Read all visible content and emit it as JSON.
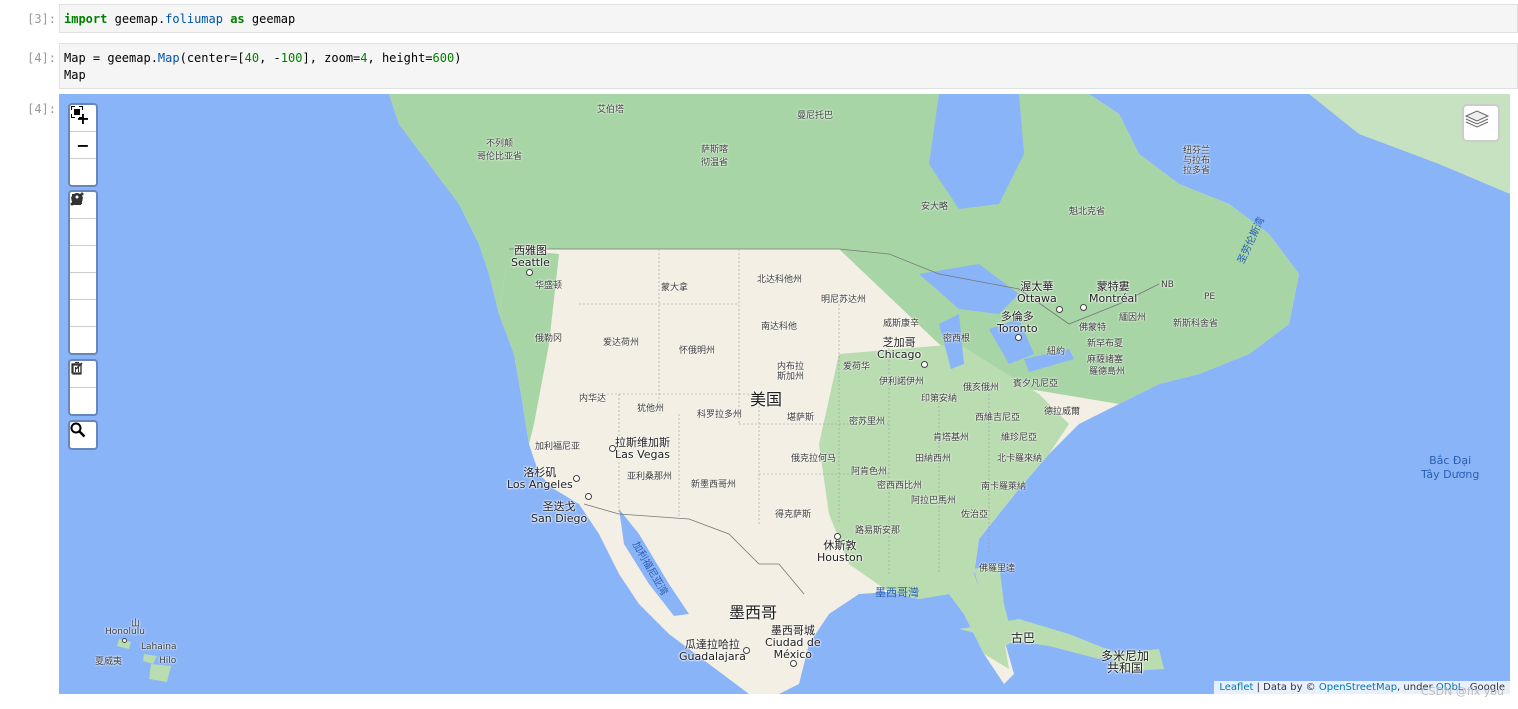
{
  "cells": [
    {
      "prompt": "[3]:",
      "code_parts": {
        "k1": "import",
        "m1": "geemap.",
        "m2": "foliumap",
        "k2": "as",
        "m3": "geemap"
      }
    },
    {
      "prompt": "[4]:",
      "line1": {
        "a": "Map = geemap.",
        "b": "Map",
        "c": "(center=[",
        "d": "40",
        "e": ", -",
        "f": "100",
        "g": "], zoom=",
        "h": "4",
        "i": ", height=",
        "j": "600",
        "k": ")"
      },
      "line2": "Map"
    },
    {
      "prompt": "[4]:"
    }
  ],
  "map": {
    "zoom_controls": {
      "zoom_in": "+",
      "zoom_out": "−"
    },
    "labels": {
      "alaska": "艾伯塔",
      "yukon": "不列颠\n哥伦比亚省",
      "alberta": "萨斯喀\n彻温省",
      "manitoba": "曼尼托巴",
      "ontario": "安大略",
      "quebec": "魁北克省",
      "newfoundland": "纽芬兰\n与拉布\n拉多省",
      "gulf_stlawrence": "圣劳伦斯湾",
      "seattle_cn": "西雅图",
      "seattle_en": "Seattle",
      "washington": "华盛顿",
      "montana": "蒙大拿",
      "north_dakota": "北达科他州",
      "minnesota": "明尼苏达州",
      "south_dakota": "南达科他",
      "wisconsin": "威斯康辛",
      "michigan": "密西根",
      "oregon": "俄勒冈",
      "idaho": "爱达荷州",
      "wyoming": "怀俄明州",
      "nebraska": "内布拉\n斯加州",
      "iowa": "爱荷华",
      "chicago_cn": "芝加哥",
      "chicago_en": "Chicago",
      "ottawa_cn": "渥太華",
      "ottawa_en": "Ottawa",
      "montreal_cn": "蒙特婁",
      "montreal_en": "Montréal",
      "toronto_cn": "多倫多",
      "toronto_en": "Toronto",
      "nb": "NB",
      "pe": "PE",
      "maine": "緬因州",
      "ns": "新斯科舍省",
      "vermont": "佛蒙特",
      "ny": "紐約",
      "nh": "新罕布夏",
      "ma": "麻薩諸塞",
      "ri": "羅德島州",
      "nevada": "内华达",
      "utah": "犹他州",
      "colorado": "科罗拉多州",
      "kansas": "堪萨斯",
      "usa": "美国",
      "missouri": "密苏里州",
      "illinois": "伊利諾伊州",
      "indiana": "印第安納",
      "ohio": "俄亥俄州",
      "pa": "賓夕凡尼亞",
      "nj": "德拉威爾",
      "wv": "西維吉尼亞",
      "va": "維珍尼亞",
      "kentucky": "肯塔基州",
      "nc": "北卡羅來納",
      "tn": "田納西州",
      "sc": "南卡羅萊納",
      "georgia": "佐治亞",
      "alabama": "阿拉巴馬州",
      "mississippi": "密西西比州",
      "arkansas": "阿肯色州",
      "oklahoma": "俄克拉何马",
      "louisiana": "路易斯安那",
      "texas": "得克萨斯",
      "california": "加利福尼亚",
      "las_vegas_cn": "拉斯维加斯",
      "las_vegas_en": "Las Vegas",
      "la_cn": "洛杉矶",
      "la_en": "Los Angeles",
      "sd_cn": "圣迭戈",
      "sd_en": "San Diego",
      "arizona": "亚利桑那州",
      "new_mexico": "新墨西哥州",
      "houston_cn": "休斯敦",
      "houston_en": "Houston",
      "florida": "佛羅里達",
      "gulf_mexico": "墨西哥灣",
      "gulf_california": "加利福尼亚湾",
      "mexico": "墨西哥",
      "guadalajara_cn": "瓜達拉哈拉",
      "guadalajara_en": "Guadalajara",
      "mexico_city_cn": "墨西哥城",
      "mexico_city_en": "Ciudad de\nMéxico",
      "cuba": "古巴",
      "dominican": "多米尼加\n共和国",
      "atlantic": "Bắc Đại\nTây Dương",
      "hawaii_mtn": "山",
      "honolulu": "Honolulu",
      "lahaina": "Lahaina",
      "hilo": "Hilo",
      "hawaii_cn": "夏威夷"
    },
    "attribution": {
      "leaflet": "Leaflet",
      "sep1": " | Data by © ",
      "osm": "OpenStreetMap",
      "sep2": ", under ",
      "odbl": "ODbL",
      "sep3": ". Google"
    }
  },
  "watermark": "CSDN @flx you",
  "colors": {
    "water": "#8ab4f8",
    "land": "#f3efe4",
    "forest": "#a8d5a6",
    "accent": "#0078a8"
  }
}
